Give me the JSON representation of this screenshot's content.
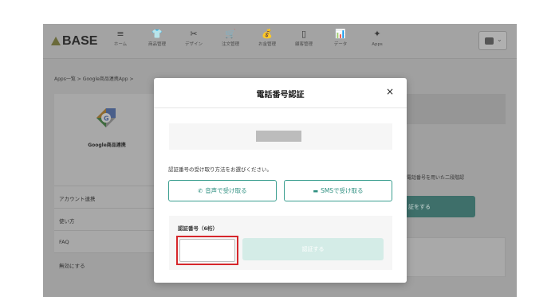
{
  "header": {
    "logo_text": "BASE",
    "nav": [
      {
        "label": "ホーム",
        "icon": "≡"
      },
      {
        "label": "商品管理",
        "icon": "👕"
      },
      {
        "label": "デザイン",
        "icon": "✂"
      },
      {
        "label": "注文管理",
        "icon": "🛒"
      },
      {
        "label": "お金管理",
        "icon": "💰"
      },
      {
        "label": "顧客管理",
        "icon": "▯"
      },
      {
        "label": "データ",
        "icon": "📊"
      },
      {
        "label": "Apps",
        "icon": "✦"
      }
    ],
    "shop_dropdown_icon": "chevron-down-icon"
  },
  "breadcrumb": "Apps一覧 > Google商品連携App >",
  "sidebar": {
    "app_title": "Google商品連携",
    "items": [
      {
        "label": "アカウント連携"
      },
      {
        "label": "使い方"
      },
      {
        "label": "FAQ"
      },
      {
        "label": "無効にする"
      }
    ]
  },
  "background": {
    "description_fragment": "電話番号を用いた二段階認",
    "button_fragment": "証をする"
  },
  "modal": {
    "title": "電話番号認証",
    "close": "×",
    "method_prompt": "認証番号の受け取り方法をお選びください。",
    "voice_button": "音声で受け取る",
    "sms_button": "SMSで受け取る",
    "code_label": "認証番号（6桁）",
    "code_value": "",
    "code_placeholder": "",
    "verify_button": "認証する"
  },
  "colors": {
    "accent": "#2e8f80",
    "verify_disabled": "#d4ece7",
    "highlight": "#d6262b"
  }
}
